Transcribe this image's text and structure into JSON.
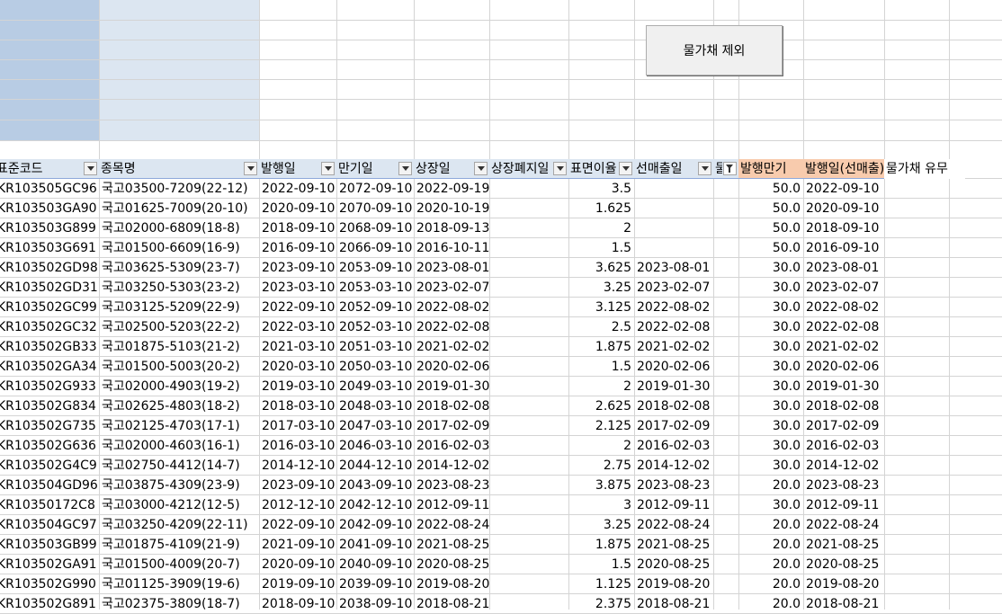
{
  "toolbar": {
    "macro_button_label": "물가채 제외"
  },
  "icons": {
    "filter": "dropdown-arrow-icon",
    "active_filter": "funnel-filter-icon"
  },
  "colors": {
    "header_blue": "#dce6f1",
    "header_orange": "#f8cbad",
    "block_dark": "#b8cce4"
  },
  "headers": [
    {
      "label": "표준코드",
      "filter": true,
      "style": "blue"
    },
    {
      "label": "종목명",
      "filter": true,
      "style": "blue"
    },
    {
      "label": "발행일",
      "filter": true,
      "style": "blue"
    },
    {
      "label": "만기일",
      "filter": true,
      "style": "blue"
    },
    {
      "label": "상장일",
      "filter": true,
      "style": "blue"
    },
    {
      "label": "상장폐지일",
      "filter": true,
      "style": "blue"
    },
    {
      "label": "표면이율",
      "filter": true,
      "style": "blue"
    },
    {
      "label": "선매출일",
      "filter": true,
      "style": "blue"
    },
    {
      "label": "물가",
      "filter": true,
      "active": true,
      "style": "blue"
    },
    {
      "label": "발행만기",
      "filter": false,
      "style": "orange"
    },
    {
      "label": "발행일(선매출)",
      "filter": false,
      "style": "orange"
    },
    {
      "label": "물가채 유무",
      "filter": false,
      "style": "plain"
    }
  ],
  "rows": [
    [
      "KR103505GC96",
      "국고03500-7209(22-12)",
      "2022-09-10",
      "2072-09-10",
      "2022-09-19",
      "",
      "3.5",
      "",
      "",
      "50.0",
      "2022-09-10",
      ""
    ],
    [
      "KR103503GA90",
      "국고01625-7009(20-10)",
      "2020-09-10",
      "2070-09-10",
      "2020-10-19",
      "",
      "1.625",
      "",
      "",
      "50.0",
      "2020-09-10",
      ""
    ],
    [
      "KR103503G899",
      "국고02000-6809(18-8)",
      "2018-09-10",
      "2068-09-10",
      "2018-09-13",
      "",
      "2",
      "",
      "",
      "50.0",
      "2018-09-10",
      ""
    ],
    [
      "KR103503G691",
      "국고01500-6609(16-9)",
      "2016-09-10",
      "2066-09-10",
      "2016-10-11",
      "",
      "1.5",
      "",
      "",
      "50.0",
      "2016-09-10",
      ""
    ],
    [
      "KR103502GD98",
      "국고03625-5309(23-7)",
      "2023-09-10",
      "2053-09-10",
      "2023-08-01",
      "",
      "3.625",
      "2023-08-01",
      "",
      "30.0",
      "2023-08-01",
      ""
    ],
    [
      "KR103502GD31",
      "국고03250-5303(23-2)",
      "2023-03-10",
      "2053-03-10",
      "2023-02-07",
      "",
      "3.25",
      "2023-02-07",
      "",
      "30.0",
      "2023-02-07",
      ""
    ],
    [
      "KR103502GC99",
      "국고03125-5209(22-9)",
      "2022-09-10",
      "2052-09-10",
      "2022-08-02",
      "",
      "3.125",
      "2022-08-02",
      "",
      "30.0",
      "2022-08-02",
      ""
    ],
    [
      "KR103502GC32",
      "국고02500-5203(22-2)",
      "2022-03-10",
      "2052-03-10",
      "2022-02-08",
      "",
      "2.5",
      "2022-02-08",
      "",
      "30.0",
      "2022-02-08",
      ""
    ],
    [
      "KR103502GB33",
      "국고01875-5103(21-2)",
      "2021-03-10",
      "2051-03-10",
      "2021-02-02",
      "",
      "1.875",
      "2021-02-02",
      "",
      "30.0",
      "2021-02-02",
      ""
    ],
    [
      "KR103502GA34",
      "국고01500-5003(20-2)",
      "2020-03-10",
      "2050-03-10",
      "2020-02-06",
      "",
      "1.5",
      "2020-02-06",
      "",
      "30.0",
      "2020-02-06",
      ""
    ],
    [
      "KR103502G933",
      "국고02000-4903(19-2)",
      "2019-03-10",
      "2049-03-10",
      "2019-01-30",
      "",
      "2",
      "2019-01-30",
      "",
      "30.0",
      "2019-01-30",
      ""
    ],
    [
      "KR103502G834",
      "국고02625-4803(18-2)",
      "2018-03-10",
      "2048-03-10",
      "2018-02-08",
      "",
      "2.625",
      "2018-02-08",
      "",
      "30.0",
      "2018-02-08",
      ""
    ],
    [
      "KR103502G735",
      "국고02125-4703(17-1)",
      "2017-03-10",
      "2047-03-10",
      "2017-02-09",
      "",
      "2.125",
      "2017-02-09",
      "",
      "30.0",
      "2017-02-09",
      ""
    ],
    [
      "KR103502G636",
      "국고02000-4603(16-1)",
      "2016-03-10",
      "2046-03-10",
      "2016-02-03",
      "",
      "2",
      "2016-02-03",
      "",
      "30.0",
      "2016-02-03",
      ""
    ],
    [
      "KR103502G4C9",
      "국고02750-4412(14-7)",
      "2014-12-10",
      "2044-12-10",
      "2014-12-02",
      "",
      "2.75",
      "2014-12-02",
      "",
      "30.0",
      "2014-12-02",
      ""
    ],
    [
      "KR103504GD96",
      "국고03875-4309(23-9)",
      "2023-09-10",
      "2043-09-10",
      "2023-08-23",
      "",
      "3.875",
      "2023-08-23",
      "",
      "20.0",
      "2023-08-23",
      ""
    ],
    [
      "KR10350172C8",
      "국고03000-4212(12-5)",
      "2012-12-10",
      "2042-12-10",
      "2012-09-11",
      "",
      "3",
      "2012-09-11",
      "",
      "30.0",
      "2012-09-11",
      ""
    ],
    [
      "KR103504GC97",
      "국고03250-4209(22-11)",
      "2022-09-10",
      "2042-09-10",
      "2022-08-24",
      "",
      "3.25",
      "2022-08-24",
      "",
      "20.0",
      "2022-08-24",
      ""
    ],
    [
      "KR103503GB99",
      "국고01875-4109(21-9)",
      "2021-09-10",
      "2041-09-10",
      "2021-08-25",
      "",
      "1.875",
      "2021-08-25",
      "",
      "20.0",
      "2021-08-25",
      ""
    ],
    [
      "KR103502GA91",
      "국고01500-4009(20-7)",
      "2020-09-10",
      "2040-09-10",
      "2020-08-25",
      "",
      "1.5",
      "2020-08-25",
      "",
      "20.0",
      "2020-08-25",
      ""
    ],
    [
      "KR103502G990",
      "국고01125-3909(19-6)",
      "2019-09-10",
      "2039-09-10",
      "2019-08-20",
      "",
      "1.125",
      "2019-08-20",
      "",
      "20.0",
      "2019-08-20",
      ""
    ],
    [
      "KR103502G891",
      "국고02375-3809(18-7)",
      "2018-09-10",
      "2038-09-10",
      "2018-08-21",
      "",
      "2.375",
      "2018-08-21",
      "",
      "20.0",
      "2018-08-21",
      ""
    ]
  ]
}
